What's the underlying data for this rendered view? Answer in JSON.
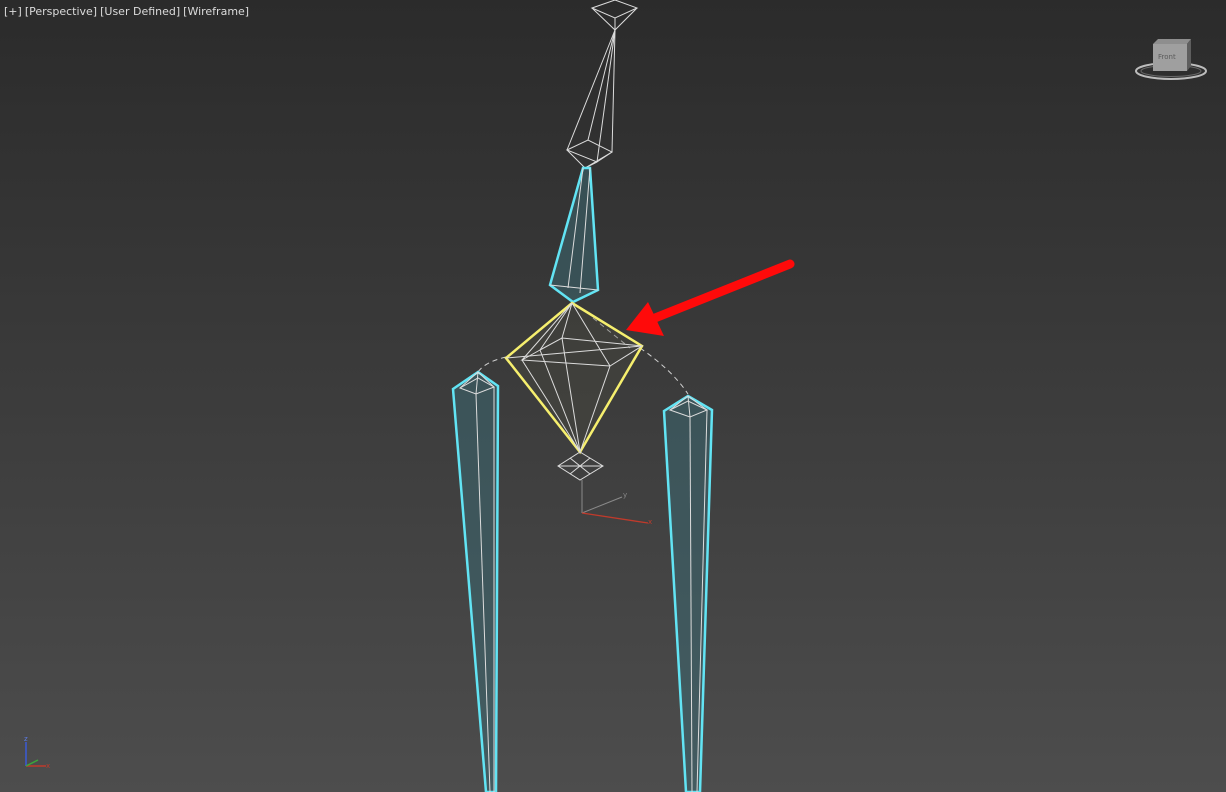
{
  "viewport": {
    "labels": [
      "[+]",
      "[Perspective]",
      "[User Defined]",
      "[Wireframe]"
    ],
    "colors": {
      "selected": "#f6ef6e",
      "biped_bone": "#62e4f4",
      "unselected_wire": "#dcdcdc",
      "annotation_arrow": "#ff0a0a",
      "axis_x": "#c03a2b",
      "axis_y": "#7a7a7a",
      "axis_z": "#3a5bd8"
    }
  },
  "viewcube": {
    "face_label": "Front",
    "icon": "viewcube-icon"
  },
  "pivot_gizmo": {
    "x_label": "x",
    "y_label": "y"
  },
  "axis_tripod": {
    "z_label": "z",
    "x_label": "x"
  }
}
